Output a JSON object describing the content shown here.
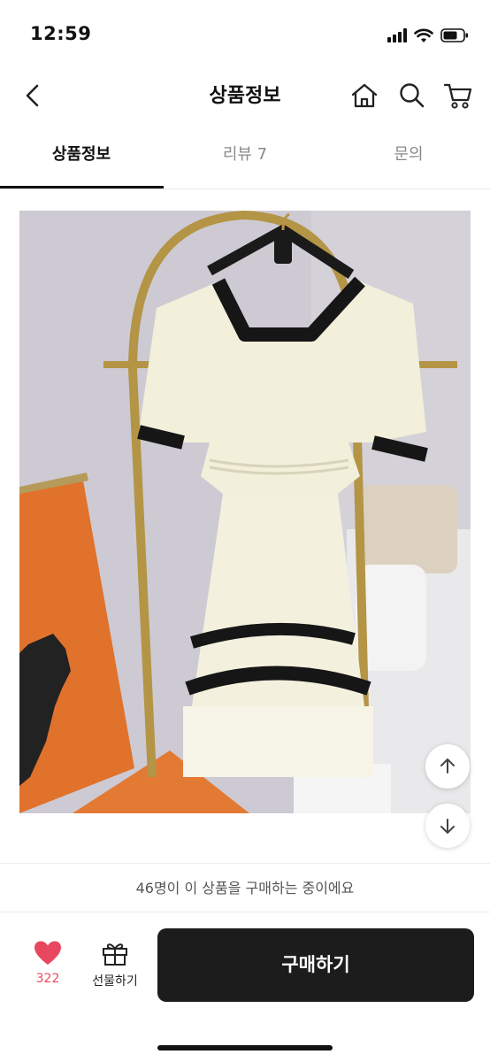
{
  "status_bar": {
    "time": "12:59"
  },
  "header": {
    "title": "상품정보"
  },
  "tabs": [
    {
      "label": "상품정보",
      "active": true
    },
    {
      "label": "리뷰 7",
      "active": false
    },
    {
      "label": "문의",
      "active": false
    }
  ],
  "notice": {
    "text": "46명이 이 상품을 구매하는 중이에요"
  },
  "action_bar": {
    "like_count": "322",
    "gift_label": "선물하기",
    "buy_label": "구매하기"
  },
  "colors": {
    "accent_like": "#e8475f",
    "buy_button": "#1c1c1c",
    "active_tab": "#111111",
    "inactive_tab": "#8a8a8a"
  },
  "icons": [
    "back-chevron-icon",
    "home-icon",
    "search-icon",
    "cart-icon",
    "scroll-up-icon",
    "scroll-down-icon",
    "heart-icon",
    "gift-icon"
  ]
}
